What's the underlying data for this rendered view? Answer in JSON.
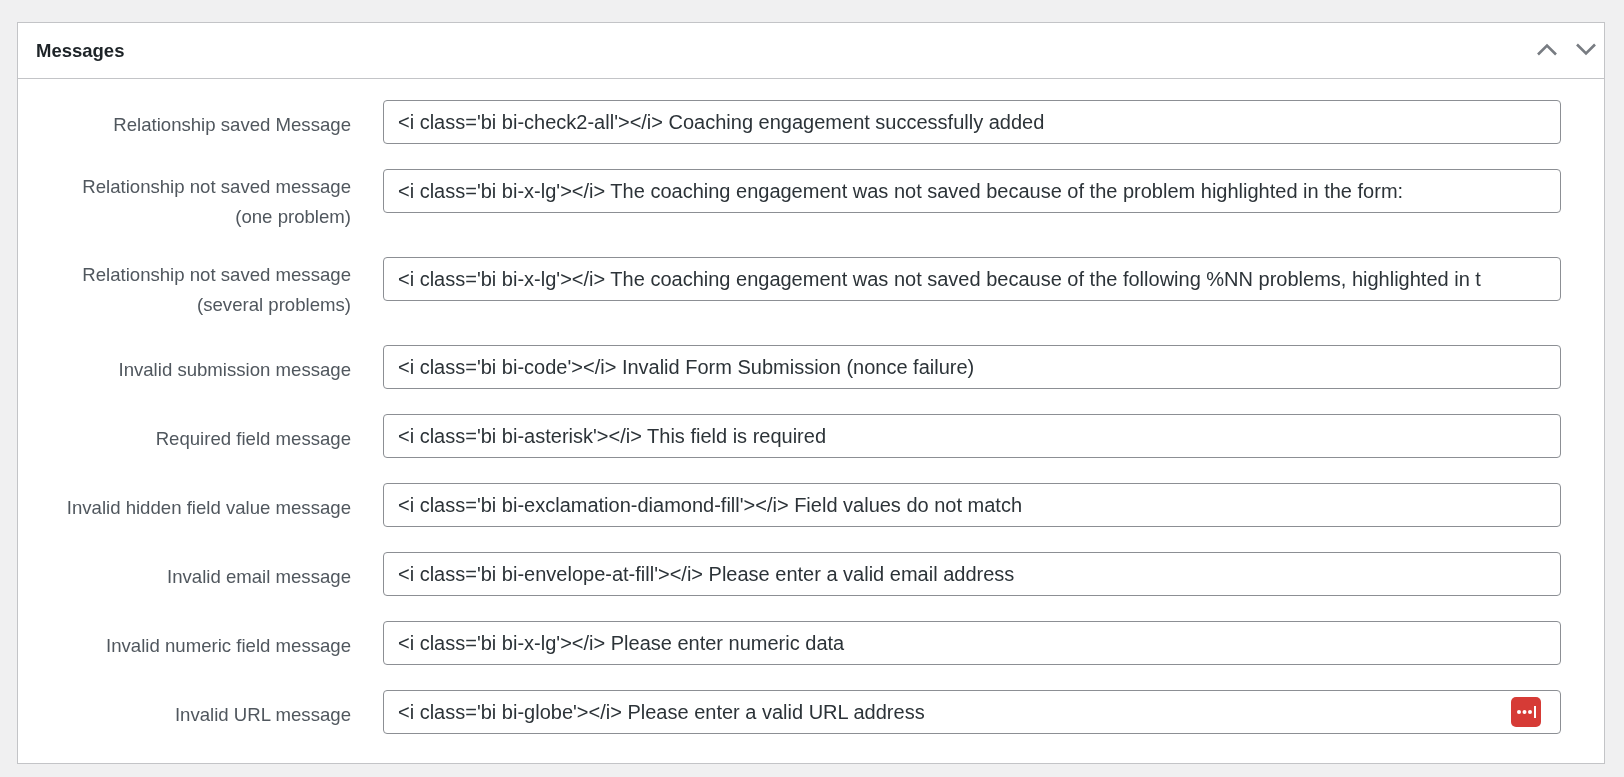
{
  "panel": {
    "title": "Messages"
  },
  "fields": [
    {
      "label": "Relationship saved Message",
      "value": "<i class='bi bi-check2-all'></i> Coaching engagement successfully added",
      "autofill_badge": false
    },
    {
      "label": "Relationship not saved message",
      "note": "(one problem)",
      "value": "<i class='bi bi-x-lg'></i> The coaching engagement was not saved because of the problem highlighted in the form:",
      "autofill_badge": false
    },
    {
      "label": "Relationship not saved message",
      "note": "(several problems)",
      "value": "<i class='bi bi-x-lg'></i> The coaching engagement was not saved because of the following %NN problems, highlighted in t",
      "autofill_badge": false
    },
    {
      "label": "Invalid submission message",
      "value": "<i class='bi bi-code'></i> Invalid Form Submission (nonce failure)",
      "autofill_badge": false
    },
    {
      "label": "Required field message",
      "value": "<i class='bi bi-asterisk'></i> This field is required",
      "autofill_badge": false
    },
    {
      "label": "Invalid hidden field value message",
      "value": "<i class='bi bi-exclamation-diamond-fill'></i> Field values do not match",
      "autofill_badge": false
    },
    {
      "label": "Invalid email message",
      "value": "<i class='bi bi-envelope-at-fill'></i> Please enter a valid email address",
      "autofill_badge": false
    },
    {
      "label": "Invalid numeric field message",
      "value": "<i class='bi bi-x-lg'></i> Please enter numeric data",
      "autofill_badge": false
    },
    {
      "label": "Invalid URL message",
      "value": "<i class='bi bi-globe'></i> Please enter a valid URL address",
      "autofill_badge": true
    }
  ]
}
